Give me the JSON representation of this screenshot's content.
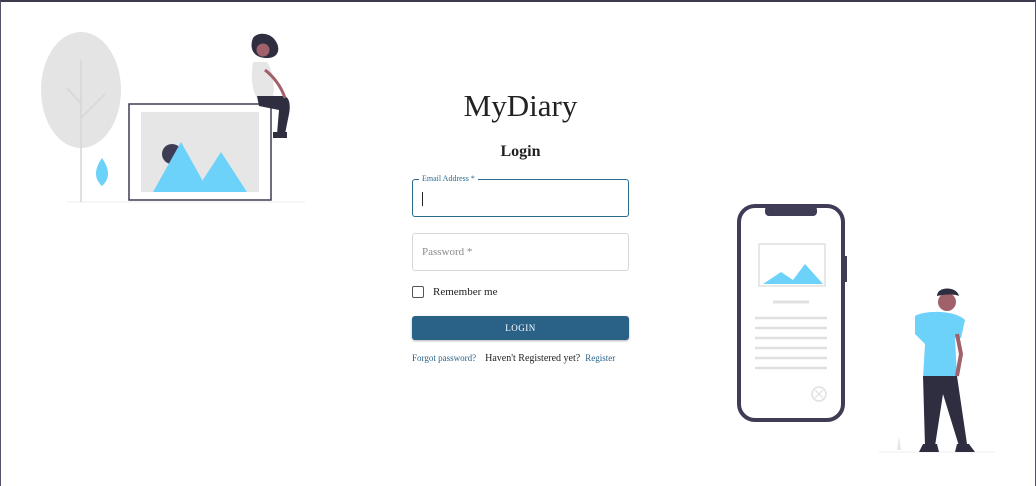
{
  "app": {
    "title": "MyDiary"
  },
  "form": {
    "heading": "Login",
    "email": {
      "label": "Email Address *",
      "value": ""
    },
    "password": {
      "placeholder": "Password *",
      "value": ""
    },
    "remember_label": "Remember me",
    "remember_checked": false,
    "login_label": "LOGIN"
  },
  "links": {
    "forgot": "Forgot password?",
    "not_registered": "Haven't Registered yet?",
    "register": "Register"
  },
  "colors": {
    "primary": "#2a6287",
    "focus": "#2a6b8c",
    "illustration_accent": "#6cd2fa",
    "illustration_dark": "#3f3d56"
  },
  "illustrations": {
    "left": "photo-frame-woman-tree-illustration",
    "right": "phone-man-illustration"
  }
}
